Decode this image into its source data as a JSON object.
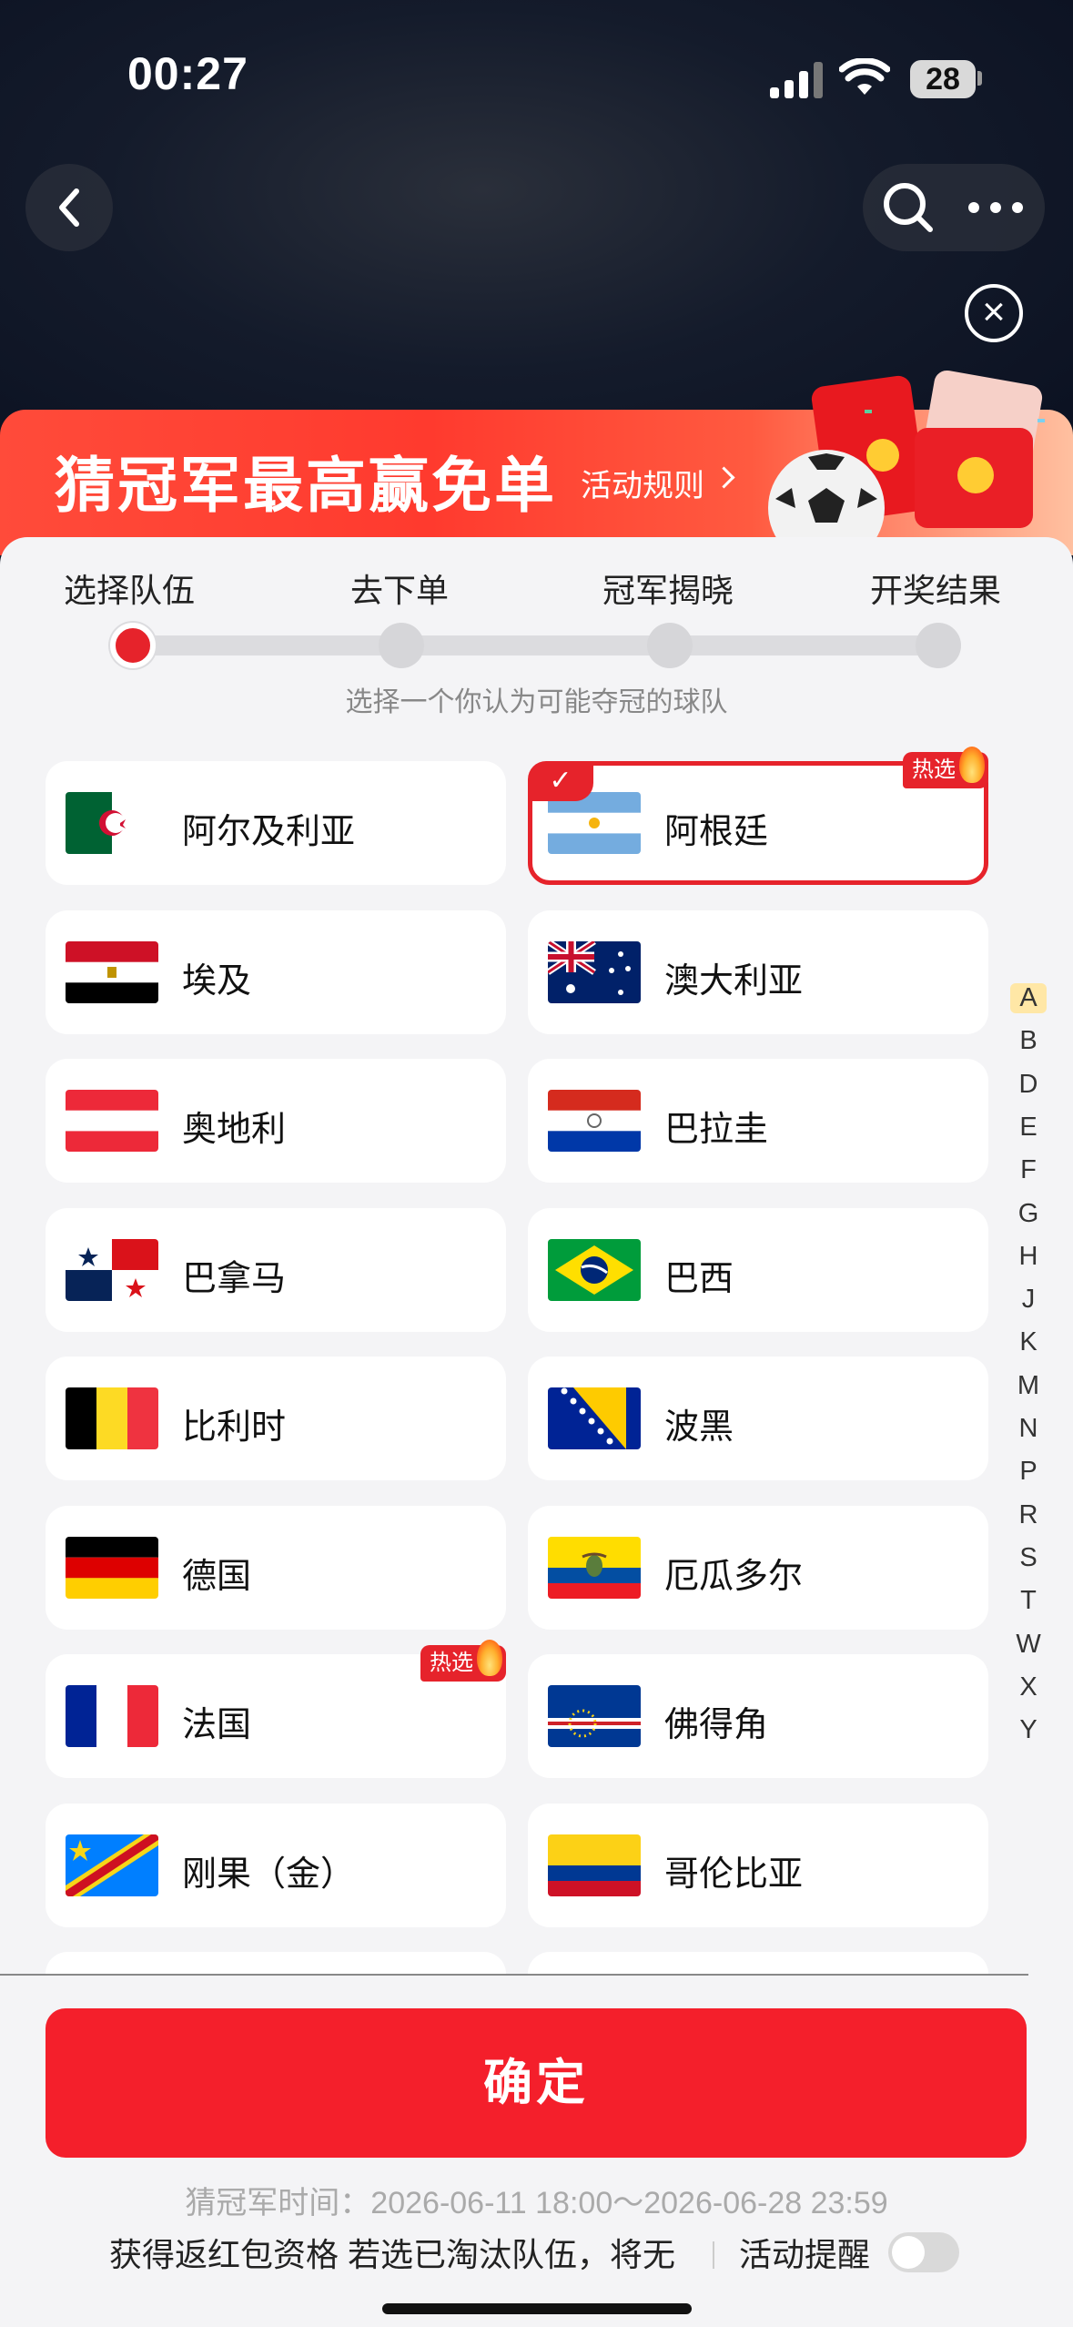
{
  "status": {
    "time": "00:27",
    "battery": "28"
  },
  "banner": {
    "title": "猜冠军最高赢免单",
    "rules_link": "活动规则"
  },
  "steps": [
    "选择队伍",
    "去下单",
    "冠军揭晓",
    "开奖结果"
  ],
  "hint": "选择一个你认为可能夺冠的球队",
  "hot_label": "热选",
  "teams": [
    {
      "name": "阿尔及利亚",
      "flag": "algeria"
    },
    {
      "name": "阿根廷",
      "flag": "argentina",
      "selected": true,
      "hot": true
    },
    {
      "name": "埃及",
      "flag": "egypt"
    },
    {
      "name": "澳大利亚",
      "flag": "australia"
    },
    {
      "name": "奥地利",
      "flag": "austria"
    },
    {
      "name": "巴拉圭",
      "flag": "paraguay"
    },
    {
      "name": "巴拿马",
      "flag": "panama"
    },
    {
      "name": "巴西",
      "flag": "brazil"
    },
    {
      "name": "比利时",
      "flag": "belgium"
    },
    {
      "name": "波黑",
      "flag": "bosnia"
    },
    {
      "name": "德国",
      "flag": "germany"
    },
    {
      "name": "厄瓜多尔",
      "flag": "ecuador"
    },
    {
      "name": "法国",
      "flag": "france",
      "hot": true
    },
    {
      "name": "佛得角",
      "flag": "cape-verde"
    },
    {
      "name": "刚果（金）",
      "flag": "dr-congo"
    },
    {
      "name": "哥伦比亚",
      "flag": "colombia"
    }
  ],
  "index_letters": [
    "A",
    "B",
    "D",
    "E",
    "F",
    "G",
    "H",
    "J",
    "K",
    "M",
    "N",
    "P",
    "R",
    "S",
    "T",
    "W",
    "X",
    "Y"
  ],
  "confirm_button": "确定",
  "time_info": "猜冠军时间：2026-06-11 18:00～2026-06-28 23:59",
  "marquee_text": "获得返红包资格   若选已淘汰队伍，将无",
  "remind_label": "活动提醒"
}
